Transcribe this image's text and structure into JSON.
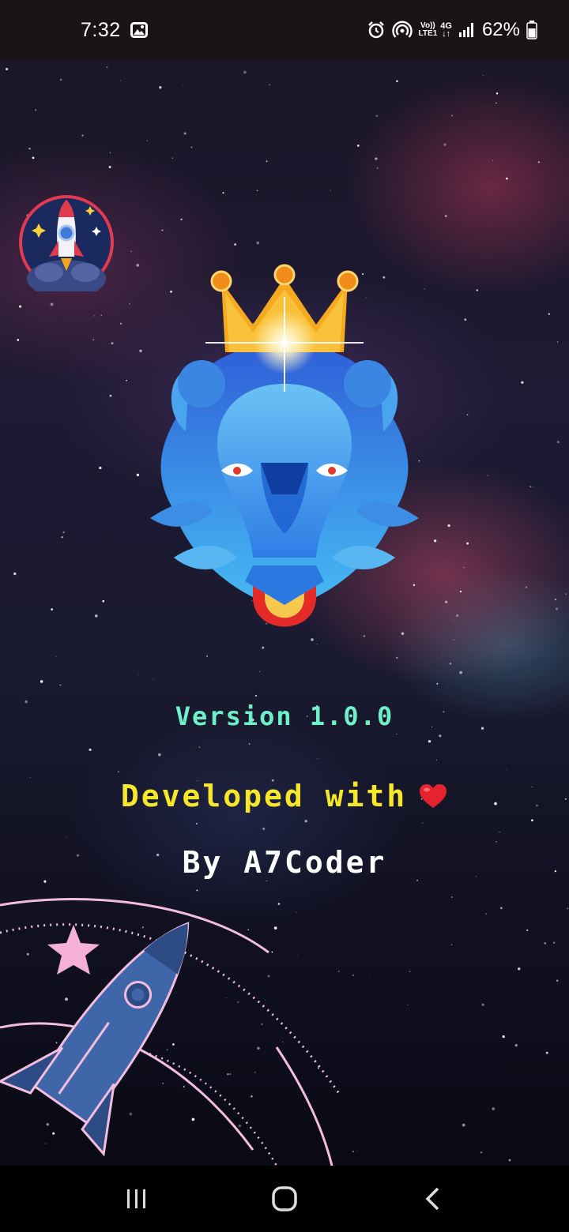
{
  "status_bar": {
    "time": "7:32",
    "net_top": "Vo))",
    "net_bottom": "LTE1",
    "net_gen": "4G",
    "battery": "62%",
    "icons": [
      "gallery-icon",
      "alarm-icon",
      "hotspot-icon",
      "signal-icon",
      "battery-icon"
    ]
  },
  "splash": {
    "version": "Version 1.0.0",
    "developed": "Developed with",
    "heart": "heart-icon",
    "author": "By A7Coder"
  },
  "nav": {
    "icons": [
      "recents-icon",
      "home-icon",
      "back-icon"
    ]
  },
  "colors": {
    "version": "#6ff0c8",
    "developed": "#f6e72a",
    "author": "#ffffff",
    "heart": "#e4232f"
  }
}
